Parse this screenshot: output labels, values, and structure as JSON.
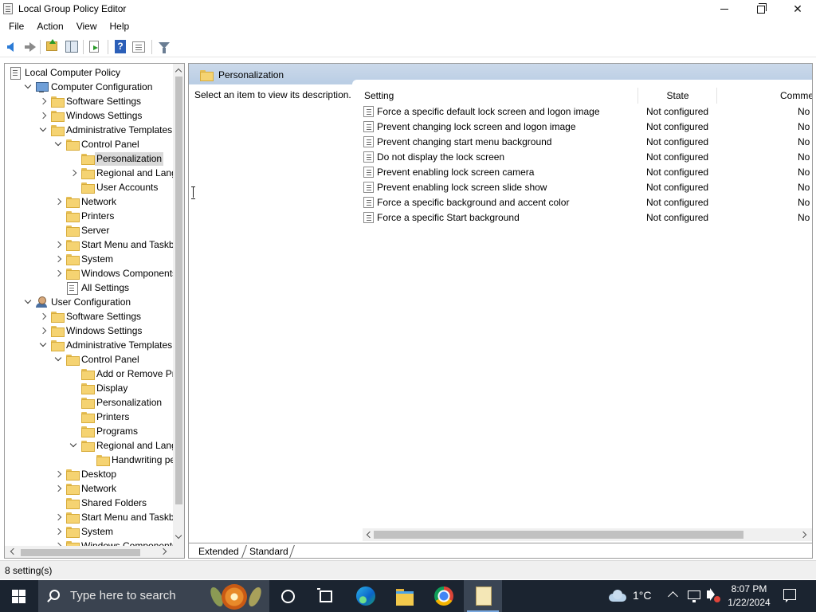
{
  "window": {
    "title": "Local Group Policy Editor",
    "minimize_icon": "minimize-icon",
    "maximize_icon": "restore-icon",
    "close_glyph": "✕"
  },
  "menu": [
    "File",
    "Action",
    "View",
    "Help"
  ],
  "toolbar": {
    "icons": [
      "back-arrow-icon",
      "forward-arrow-icon",
      "up-one-level-icon",
      "show-hide-tree-icon",
      "export-list-icon",
      "help-icon",
      "properties-icon",
      "filter-icon"
    ],
    "help_glyph": "?"
  },
  "tree": {
    "items": [
      {
        "label": "Local Computer Policy",
        "icon": "policy-icon"
      },
      {
        "label": "Computer Configuration",
        "icon": "computer-icon",
        "expander": "open"
      },
      {
        "label": "Software Settings",
        "icon": "folder-icon",
        "expander": "closed"
      },
      {
        "label": "Windows Settings",
        "icon": "folder-icon",
        "expander": "closed"
      },
      {
        "label": "Administrative Templates",
        "icon": "folder-icon",
        "expander": "open"
      },
      {
        "label": "Control Panel",
        "icon": "folder-icon",
        "expander": "open"
      },
      {
        "label": "Personalization",
        "icon": "folder-icon",
        "selected": true
      },
      {
        "label": "Regional and Langua",
        "icon": "folder-icon",
        "expander": "closed"
      },
      {
        "label": "User Accounts",
        "icon": "folder-icon"
      },
      {
        "label": "Network",
        "icon": "folder-icon",
        "expander": "closed"
      },
      {
        "label": "Printers",
        "icon": "folder-icon"
      },
      {
        "label": "Server",
        "icon": "folder-icon"
      },
      {
        "label": "Start Menu and Taskbar",
        "icon": "folder-icon",
        "expander": "closed"
      },
      {
        "label": "System",
        "icon": "folder-icon",
        "expander": "closed"
      },
      {
        "label": "Windows Components",
        "icon": "folder-icon",
        "expander": "closed"
      },
      {
        "label": "All Settings",
        "icon": "all-settings-icon"
      },
      {
        "label": "User Configuration",
        "icon": "user-icon",
        "expander": "open"
      },
      {
        "label": "Software Settings",
        "icon": "folder-icon",
        "expander": "closed"
      },
      {
        "label": "Windows Settings",
        "icon": "folder-icon",
        "expander": "closed"
      },
      {
        "label": "Administrative Templates",
        "icon": "folder-icon",
        "expander": "open"
      },
      {
        "label": "Control Panel",
        "icon": "folder-icon",
        "expander": "open"
      },
      {
        "label": "Add or Remove Prog",
        "icon": "folder-icon"
      },
      {
        "label": "Display",
        "icon": "folder-icon"
      },
      {
        "label": "Personalization",
        "icon": "folder-icon"
      },
      {
        "label": "Printers",
        "icon": "folder-icon"
      },
      {
        "label": "Programs",
        "icon": "folder-icon"
      },
      {
        "label": "Regional and Langua",
        "icon": "folder-icon",
        "expander": "open"
      },
      {
        "label": "Handwriting pers",
        "icon": "folder-icon"
      },
      {
        "label": "Desktop",
        "icon": "folder-icon",
        "expander": "closed"
      },
      {
        "label": "Network",
        "icon": "folder-icon",
        "expander": "closed"
      },
      {
        "label": "Shared Folders",
        "icon": "folder-icon"
      },
      {
        "label": "Start Menu and Taskbar",
        "icon": "folder-icon",
        "expander": "closed"
      },
      {
        "label": "System",
        "icon": "folder-icon",
        "expander": "closed"
      },
      {
        "label": "Windows Components",
        "icon": "folder-icon",
        "expander": "closed"
      }
    ]
  },
  "content": {
    "header_title": "Personalization",
    "description": "Select an item to view its description.",
    "columns": {
      "setting": "Setting",
      "state": "State",
      "comment": "Comme"
    },
    "policies": [
      {
        "name": "Force a specific default lock screen and logon image",
        "state": "Not configured",
        "comment": "No"
      },
      {
        "name": "Prevent changing lock screen and logon image",
        "state": "Not configured",
        "comment": "No"
      },
      {
        "name": "Prevent changing start menu background",
        "state": "Not configured",
        "comment": "No"
      },
      {
        "name": "Do not display the lock screen",
        "state": "Not configured",
        "comment": "No"
      },
      {
        "name": "Prevent enabling lock screen camera",
        "state": "Not configured",
        "comment": "No"
      },
      {
        "name": "Prevent enabling lock screen slide show",
        "state": "Not configured",
        "comment": "No"
      },
      {
        "name": "Force a specific background and accent color",
        "state": "Not configured",
        "comment": "No"
      },
      {
        "name": "Force a specific Start background",
        "state": "Not configured",
        "comment": "No"
      }
    ],
    "tabs": [
      "Extended",
      "Standard"
    ]
  },
  "status": {
    "text": "8 setting(s)"
  },
  "taskbar": {
    "search_placeholder": "Type here to search",
    "apps": [
      "cortana-icon",
      "task-view-icon",
      "edge-icon",
      "file-explorer-icon",
      "chrome-icon",
      "group-policy-editor-icon"
    ],
    "weather": "1°C",
    "time": "8:07 PM",
    "date": "1/22/2024"
  }
}
